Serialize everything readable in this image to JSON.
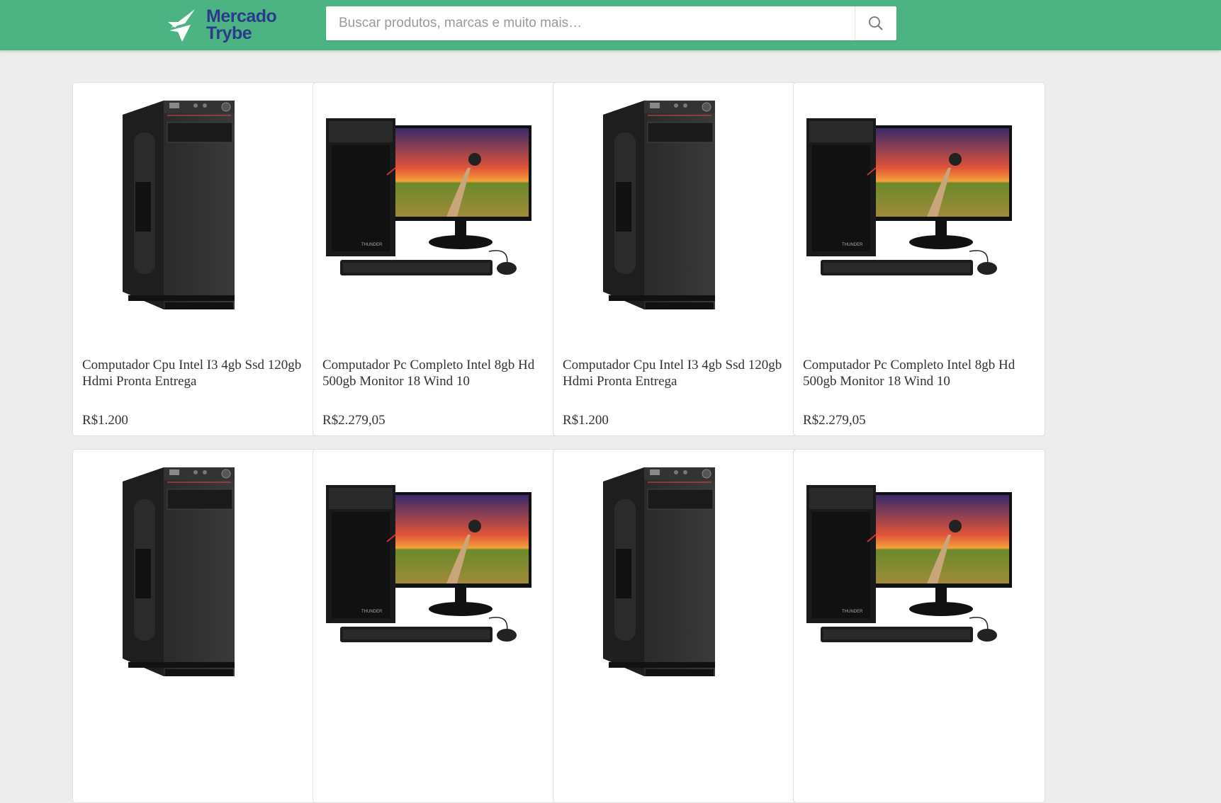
{
  "header": {
    "brand_line1": "Mercado",
    "brand_line2": "Trybe",
    "search_placeholder": "Buscar produtos, marcas e muito mais…",
    "search_icon": "search-icon",
    "bg_color": "#4cb482",
    "brand_color": "#2b3a8a"
  },
  "products": [
    {
      "title": "Computador Cpu Intel I3 4gb Ssd 120gb Hdmi Pronta Entrega",
      "price": "R$1.200",
      "image": "pc-tower"
    },
    {
      "title": "Computador Pc Completo Intel 8gb Hd 500gb Monitor 18 Wind 10",
      "price": "R$2.279,05",
      "image": "pc-with-monitor"
    },
    {
      "title": "Computador Cpu Intel I3 4gb Ssd 120gb Hdmi Pronta Entrega",
      "price": "R$1.200",
      "image": "pc-tower"
    },
    {
      "title": "Computador Pc Completo Intel 8gb Hd 500gb Monitor 18 Wind 10",
      "price": "R$2.279,05",
      "image": "pc-with-monitor"
    },
    {
      "title": "",
      "price": "",
      "image": "pc-tower"
    },
    {
      "title": "",
      "price": "",
      "image": "pc-with-monitor"
    },
    {
      "title": "",
      "price": "",
      "image": "pc-tower"
    },
    {
      "title": "",
      "price": "",
      "image": "pc-with-monitor"
    }
  ]
}
